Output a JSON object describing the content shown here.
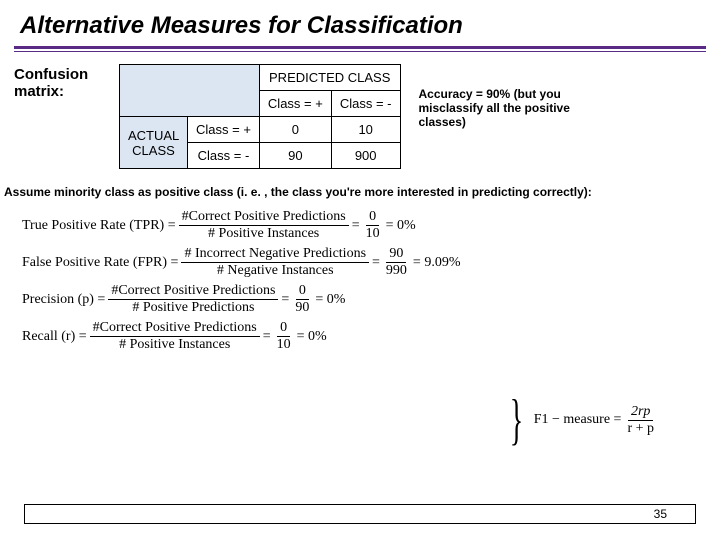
{
  "title": "Alternative Measures for Classification",
  "confusion_matrix_label": "Confusion matrix:",
  "predicted_header": "PREDICTED CLASS",
  "actual_header": "ACTUAL CLASS",
  "col_headers": [
    "Class = +",
    "Class = -"
  ],
  "row_headers": [
    "Class = +",
    "Class = -"
  ],
  "cells": [
    [
      "0",
      "10"
    ],
    [
      "90",
      "900"
    ]
  ],
  "accuracy_note": "Accuracy = 90% (but you misclassify all the positive classes)",
  "assume_text": "Assume minority class as positive class (i. e. , the class you're more interested in predicting correctly):",
  "equations": {
    "tpr": {
      "label": "True Positive Rate (TPR) =",
      "num1": "#Correct Positive Predictions",
      "den1": "# Positive Instances",
      "num2": "0",
      "den2": "10",
      "result": "= 0%"
    },
    "fpr": {
      "label": "False Positive Rate (FPR) =",
      "num1": "# Incorrect Negative Predictions",
      "den1": "# Negative Instances",
      "num2": "90",
      "den2": "990",
      "result": "= 9.09%"
    },
    "precision": {
      "label": "Precision (p) =",
      "num1": "#Correct Positive Predictions",
      "den1": "# Positive Predictions",
      "num2": "0",
      "den2": "90",
      "result": "= 0%"
    },
    "recall": {
      "label": "Recall (r) =",
      "num1": "#Correct Positive Predictions",
      "den1": "# Positive Instances",
      "num2": "0",
      "den2": "10",
      "result": "= 0%"
    },
    "f1": {
      "label": "F1 − measure =",
      "num": "2rp",
      "den": "r + p"
    }
  },
  "page_number": "35",
  "chart_data": {
    "type": "table",
    "title": "Confusion matrix",
    "row_label": "ACTUAL CLASS",
    "col_label": "PREDICTED CLASS",
    "categories": [
      "Class = +",
      "Class = -"
    ],
    "series": [
      {
        "name": "Class = +",
        "values": [
          0,
          10
        ]
      },
      {
        "name": "Class = -",
        "values": [
          90,
          900
        ]
      }
    ]
  }
}
